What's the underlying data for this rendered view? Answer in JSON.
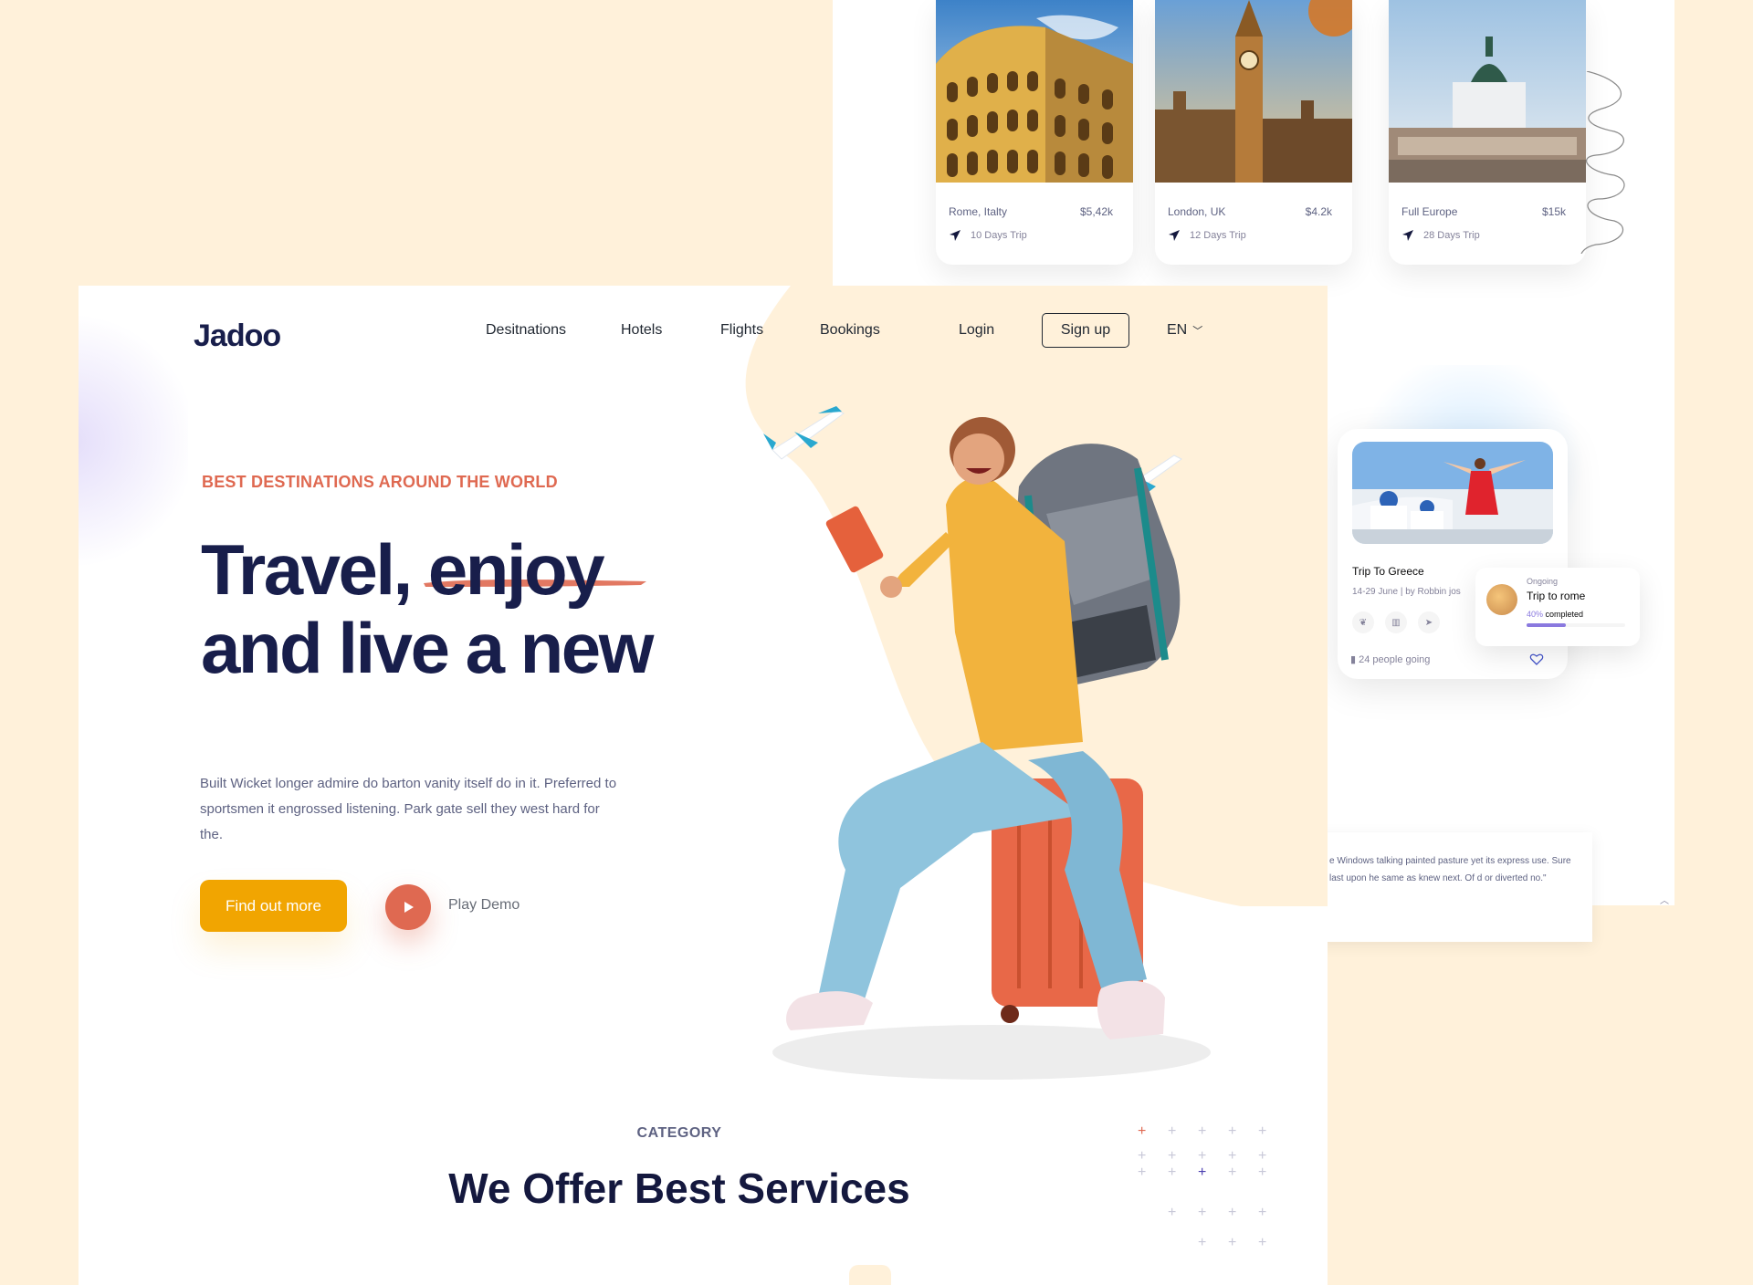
{
  "destinations": [
    {
      "place": "Rome, Italty",
      "price": "$5,42k",
      "trip": "10 Days Trip"
    },
    {
      "place": "London, UK",
      "price": "$4.2k",
      "trip": "12 Days Trip"
    },
    {
      "place": "Full Europe",
      "price": "$15k",
      "trip": "28 Days Trip"
    }
  ],
  "greece": {
    "title": "Trip To Greece",
    "meta": "14-29 June  |  by Robbin jos",
    "going": "24 people going"
  },
  "ongoing": {
    "label": "Ongoing",
    "title": "Trip to rome",
    "percent": "40%",
    "completed": " completed",
    "progress": 0.4
  },
  "testimonial": {
    "text": "e Windows talking painted pasture yet its express use. Sure last upon he same as knew next. Of d or diverted no.\""
  },
  "nav": {
    "logo": "Jadoo",
    "items": [
      "Desitnations",
      "Hotels",
      "Flights",
      "Bookings"
    ],
    "login": "Login",
    "signup": "Sign up",
    "lang": "EN"
  },
  "hero": {
    "eyebrow": "BEST DESTINATIONS AROUND THE WORLD",
    "line1": "Travel, enjoy",
    "line2": "and live a new",
    "paragraph": "Built Wicket longer admire do barton vanity itself do in it. Preferred to sportsmen it engrossed listening. Park gate sell they west hard for the.",
    "cta": "Find out more",
    "play": "Play Demo"
  },
  "section": {
    "eyebrow": "CATEGORY",
    "title": "We Offer Best Services"
  },
  "colors": {
    "accent": "#df6951",
    "primary": "#181e4b",
    "button": "#f1a501",
    "background": "#fff1da",
    "progress": "#8a79df"
  }
}
